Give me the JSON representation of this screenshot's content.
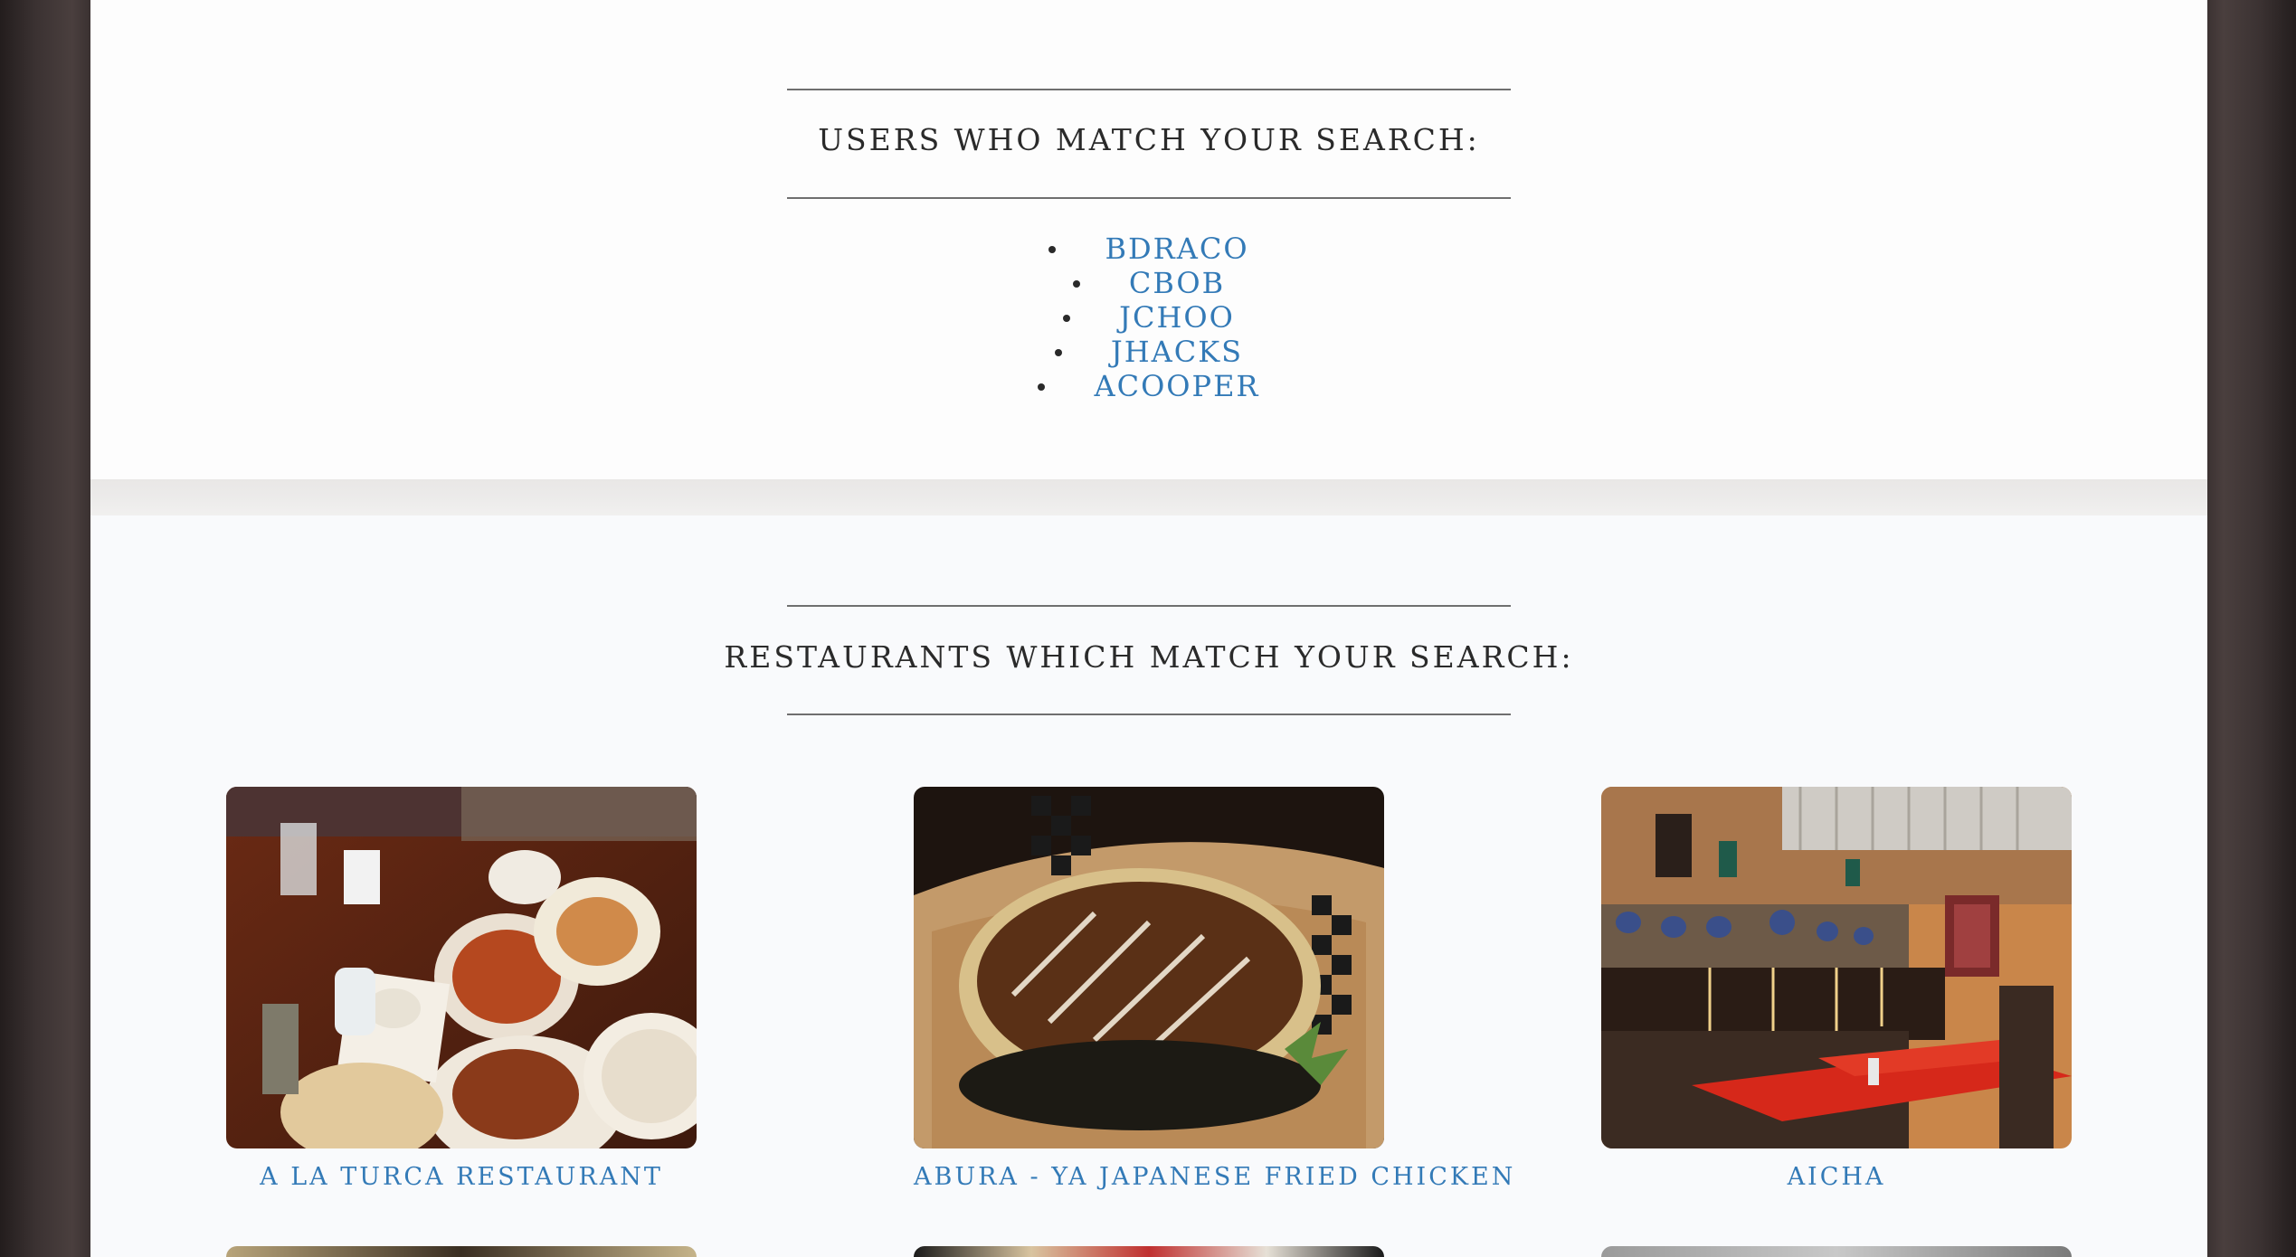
{
  "users_section": {
    "heading": "USERS WHO MATCH YOUR SEARCH:",
    "users": [
      "BDRACO",
      "CBOB",
      "JCHOO",
      "JHACKS",
      "ACOOPER"
    ]
  },
  "restaurants_section": {
    "heading": "RESTAURANTS WHICH MATCH YOUR SEARCH:",
    "restaurants": [
      {
        "name": "A LA TURCA RESTAURANT"
      },
      {
        "name": "ABURA - YA JAPANESE FRIED CHICKEN"
      },
      {
        "name": "AICHA"
      }
    ]
  },
  "colors": {
    "link": "#337ab7",
    "heading_text": "#2a2a2a",
    "frame": "#2a2424"
  }
}
